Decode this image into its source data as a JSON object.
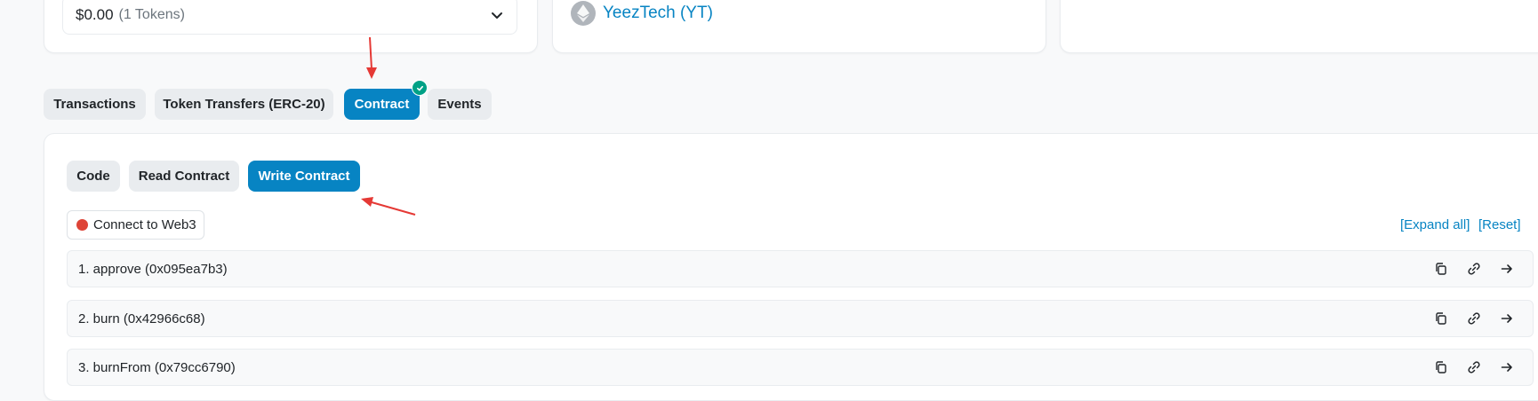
{
  "holdings": {
    "amount": "$0.00",
    "tokens": "(1 Tokens)"
  },
  "token": {
    "name": "YeezTech (YT)"
  },
  "tabs": [
    {
      "label": "Transactions"
    },
    {
      "label": "Token Transfers (ERC-20)"
    },
    {
      "label": "Contract"
    },
    {
      "label": "Events"
    }
  ],
  "active_tab": "Contract",
  "subtabs": [
    {
      "label": "Code"
    },
    {
      "label": "Read Contract"
    },
    {
      "label": "Write Contract"
    }
  ],
  "active_subtab": "Write Contract",
  "connect_label": "Connect to Web3",
  "expand_all": "[Expand all]",
  "reset": "[Reset]",
  "functions": [
    {
      "label": "1. approve (0x095ea7b3)"
    },
    {
      "label": "2. burn (0x42966c68)"
    },
    {
      "label": "3. burnFrom (0x79cc6790)"
    }
  ],
  "colors": {
    "accent": "#0784c3",
    "success": "#00a186",
    "danger": "#de4437",
    "annotation": "#e53935"
  },
  "icons": [
    "chevron-down-icon",
    "ethereum-icon",
    "check-icon",
    "copy-icon",
    "link-icon",
    "arrow-right-icon"
  ]
}
